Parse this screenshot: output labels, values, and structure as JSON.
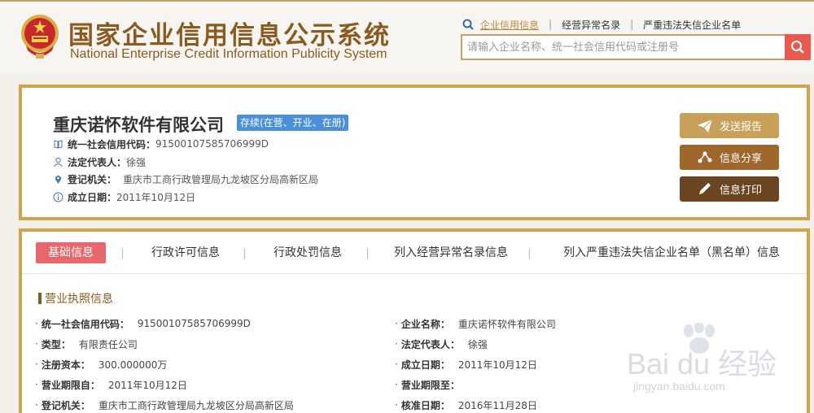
{
  "header": {
    "title_cn": "国家企业信用信息公示系统",
    "title_en": "National Enterprise Credit Information Publicity System",
    "links": [
      "企业信用信息",
      "经营异常名录",
      "严重违法失信企业名单"
    ],
    "search_placeholder": "请输入企业名称、统一社会信用代码或注册号"
  },
  "company": {
    "name": "重庆诺怀软件有限公司",
    "status": "存续(在营、开业、在册)",
    "credit_code_label": "统一社会信用代码：",
    "credit_code": "91500107585706999D",
    "legal_rep_label": "法定代表人：",
    "legal_rep": "徐强",
    "authority_label": "登记机关：",
    "authority": "重庆市工商行政管理局九龙坡区分局高新区局",
    "established_label": "成立日期：",
    "established": "2011年10月12日"
  },
  "actions": {
    "send_report": "发送报告",
    "share": "信息分享",
    "print": "信息打印"
  },
  "tabs": [
    "基础信息",
    "行政许可信息",
    "行政处罚信息",
    "列入经营异常名录信息",
    "列入严重违法失信企业名单（黑名单）信息"
  ],
  "license": {
    "section_title": "营业执照信息",
    "fields": [
      {
        "label": "统一社会信用代码：",
        "value": "91500107585706999D"
      },
      {
        "label": "企业名称：",
        "value": "重庆诺怀软件有限公司"
      },
      {
        "label": "类型：",
        "value": "有限责任公司"
      },
      {
        "label": "法定代表人：",
        "value": "徐强"
      },
      {
        "label": "注册资本：",
        "value": "300.000000万"
      },
      {
        "label": "成立日期：",
        "value": "2011年10月12日"
      },
      {
        "label": "营业期限自：",
        "value": "2011年10月12日"
      },
      {
        "label": "营业期限至：",
        "value": ""
      },
      {
        "label": "登记机关：",
        "value": "重庆市工商行政管理局九龙坡区分局高新区局"
      },
      {
        "label": "核准日期：",
        "value": "2016年11月28日"
      }
    ]
  },
  "watermark": {
    "text": "Bai du 经验",
    "url": "jingyan.baidu.com"
  },
  "colors": {
    "accent": "#d1a34d",
    "brand_text": "#8b5a1e",
    "status_badge": "#4a90d9",
    "active_tab": "#e8676a",
    "search_button": "#e85a4f"
  }
}
